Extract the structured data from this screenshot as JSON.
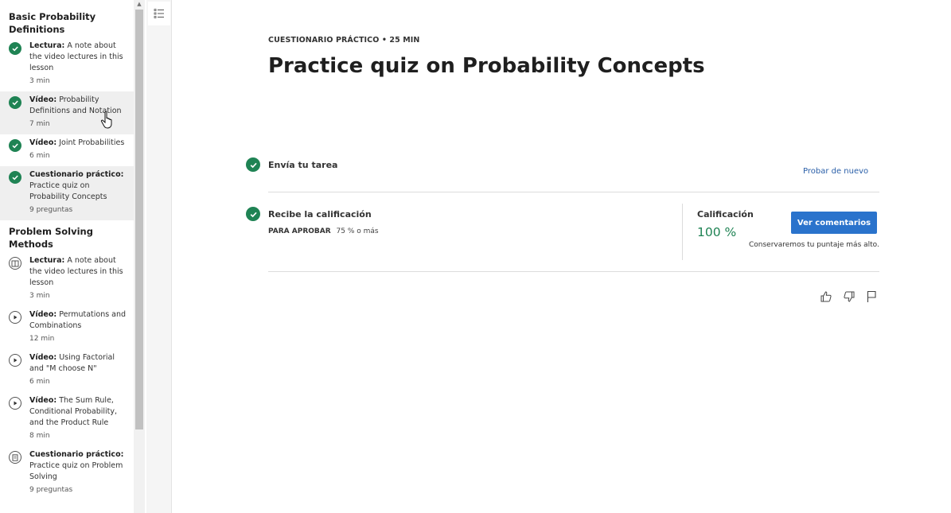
{
  "sidebar": {
    "sections": [
      {
        "title": "Basic Probability Definitions",
        "items": [
          {
            "type": "Lectura:",
            "name": "A note about the video lectures in this lesson",
            "meta": "3 min",
            "status": "complete"
          },
          {
            "type": "Vídeo:",
            "name": "Probability Definitions and Notation",
            "meta": "7 min",
            "status": "complete"
          },
          {
            "type": "Vídeo:",
            "name": "Joint Probabilities",
            "meta": "6 min",
            "status": "complete"
          },
          {
            "type": "Cuestionario práctico:",
            "name": "Practice quiz on Probability Concepts",
            "meta": "9 preguntas",
            "status": "complete"
          }
        ]
      },
      {
        "title": "Problem Solving Methods",
        "items": [
          {
            "type": "Lectura:",
            "name": "A note about the video lectures in this lesson",
            "meta": "3 min",
            "status": "reading"
          },
          {
            "type": "Vídeo:",
            "name": "Permutations and Combinations",
            "meta": "12 min",
            "status": "video"
          },
          {
            "type": "Vídeo:",
            "name": "Using Factorial and \"M choose N\"",
            "meta": "6 min",
            "status": "video"
          },
          {
            "type": "Vídeo:",
            "name": "The Sum Rule, Conditional Probability, and the Product Rule",
            "meta": "8 min",
            "status": "video"
          },
          {
            "type": "Cuestionario práctico:",
            "name": "Practice quiz on Problem Solving",
            "meta": "9 preguntas",
            "status": "quiz"
          }
        ]
      }
    ]
  },
  "main": {
    "eyebrow": "CUESTIONARIO PRÁCTICO • 25 MIN",
    "title": "Practice quiz on Probability Concepts",
    "step1": {
      "label": "Envía tu tarea",
      "link": "Probar de nuevo"
    },
    "step2": {
      "label": "Recibe la calificación",
      "pass_label": "PARA APROBAR",
      "pass_value": "75 % o más",
      "grade_label": "Calificación",
      "grade_value": "100 %",
      "button": "Ver comentarios",
      "note": "Conservaremos tu puntaje más alto."
    }
  },
  "colors": {
    "success": "#1f8354",
    "primary": "#2a73cc",
    "link": "#2a5fa8"
  },
  "icons": [
    "check-circle-icon",
    "reading-icon",
    "play-icon",
    "quiz-icon",
    "list-icon",
    "thumbs-up-icon",
    "thumbs-down-icon",
    "flag-icon"
  ]
}
